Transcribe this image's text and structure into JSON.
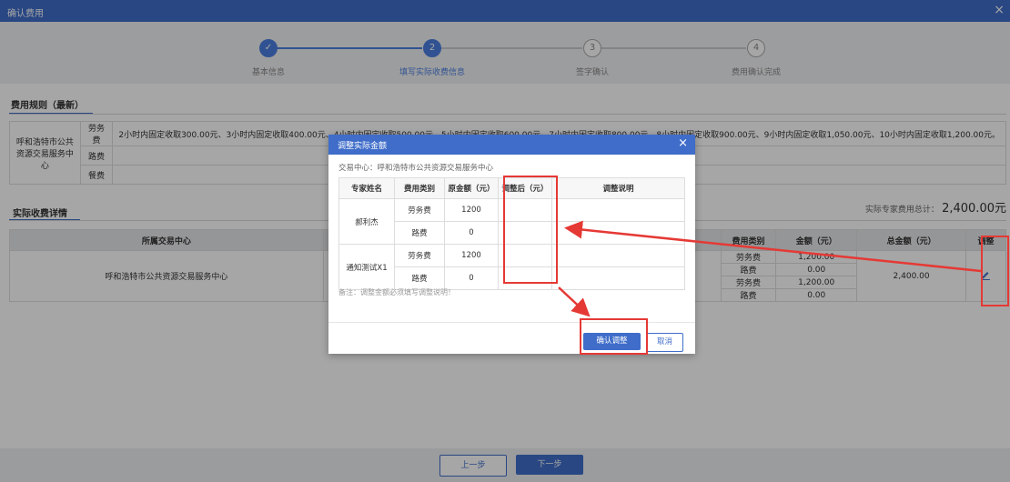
{
  "window": {
    "title": "确认费用",
    "close_icon": "×"
  },
  "steps": [
    {
      "label": "基本信息",
      "status": "done",
      "mark": "✓"
    },
    {
      "label": "填写实际收费信息",
      "status": "current",
      "mark": "2"
    },
    {
      "label": "签字确认",
      "status": "todo",
      "mark": "3"
    },
    {
      "label": "费用确认完成",
      "status": "todo",
      "mark": "4"
    }
  ],
  "rules_section": {
    "title": "费用规则（最新）",
    "center": "呼和浩特市公共资源交易服务中心",
    "rows": [
      {
        "type": "劳务费",
        "desc": "2小时内固定收取300.00元、3小时内固定收取400.00元、4小时内固定收取500.00元、5小时内固定收取600.00元、7小时内固定收取800.00元、8小时内固定收取900.00元、9小时内固定收取1,050.00元、10小时内固定收取1,200.00元。"
      },
      {
        "type": "路费",
        "desc": ""
      },
      {
        "type": "餐费",
        "desc": ""
      }
    ]
  },
  "detail_section": {
    "title": "实际收费详情",
    "total_label": "实际专家费用总计：",
    "total_value": "2,400.00元",
    "headers": {
      "center": "所属交易中心",
      "type": "费用类别",
      "amount": "金额（元）",
      "total": "总金额（元）",
      "adjust": "调整"
    },
    "center": "呼和浩特市公共资源交易服务中心",
    "rows": [
      {
        "type": "劳务费",
        "amount": "1,200.00"
      },
      {
        "type": "路费",
        "amount": "0.00"
      },
      {
        "type": "劳务费",
        "amount": "1,200.00"
      },
      {
        "type": "路费",
        "amount": "0.00"
      }
    ],
    "total_amount": "2,400.00"
  },
  "footer": {
    "prev": "上一步",
    "next": "下一步"
  },
  "modal": {
    "title": "调整实际金额",
    "center_label": "交易中心：呼和浩特市公共资源交易服务中心",
    "headers": {
      "name": "专家姓名",
      "type": "费用类别",
      "orig": "原金额（元）",
      "adjusted": "调整后（元）",
      "note": "调整说明"
    },
    "experts": [
      {
        "name": "郝利杰",
        "items": [
          {
            "type": "劳务费",
            "orig": "1200"
          },
          {
            "type": "路费",
            "orig": "0"
          }
        ]
      },
      {
        "name": "通知测试X1",
        "items": [
          {
            "type": "劳务费",
            "orig": "1200"
          },
          {
            "type": "路费",
            "orig": "0"
          }
        ]
      }
    ],
    "remark": "备注：调整金额必须填写调整说明！",
    "confirm": "确认调整",
    "cancel": "取消"
  },
  "colors": {
    "primary": "#3f6dc9",
    "highlight": "#e53935"
  }
}
